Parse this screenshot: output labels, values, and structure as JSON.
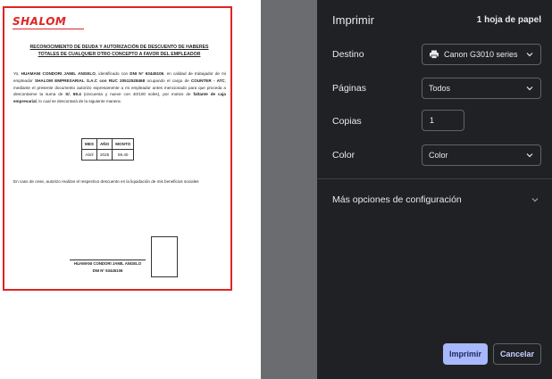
{
  "document": {
    "logo_text": "SHALOM",
    "title_line1": "RECONOCIMIENTO DE DEUDA Y AUTORIZACIÓN DE DESCUENTO DE HABERES",
    "title_line2": "TOTALES DE CUALQUIER OTRO CONCEPTO A FAVOR DEL EMPLEADOR",
    "body_p1": "Yo, ",
    "body_name": "HUAMANI CONDORI JAMIL ANGELO",
    "body_p2": ", identificado con ",
    "body_dni": "DNI N° 63445106",
    "body_p3": ", en calidad de trabajador de mi empleador ",
    "body_company": "SHALOM EMPRESARIAL S.A.C con RUC 20512528468",
    "body_p4": " ocupando el cargo de ",
    "body_role": "COUNTER - ATC",
    "body_p5": ", mediante el presente documento autorizo expresamente a mi empleador antes mencionado para que proceda a descontarme la suma de ",
    "body_amount": "S/. 59.4",
    "body_p6": " (cincuenta y nueve con 40/100 soles), por motivo de ",
    "body_reason": "faltante de caja empresarial",
    "body_p7": ", lo cual se descontará de la siguiente manera:",
    "table": {
      "headers": [
        "MES",
        "AÑO",
        "MONTO"
      ],
      "row": [
        "Abril",
        "2025",
        "59.40"
      ]
    },
    "cese_text": "En caso de cese, autorizo realizar el respectivo descuento en la liquidación de mis beneficios sociales",
    "signature_name": "HUAMANI CONDORI JAMIL ANGELO",
    "signature_dni": "DNI N° 63445106"
  },
  "panel": {
    "title": "Imprimir",
    "sheet_count": "1 hoja de papel",
    "destino_label": "Destino",
    "destino_value": "Canon G3010 series",
    "paginas_label": "Páginas",
    "paginas_value": "Todos",
    "copias_label": "Copias",
    "copias_value": "1",
    "color_label": "Color",
    "color_value": "Color",
    "more_options": "Más opciones de configuración",
    "print_button": "Imprimir",
    "cancel_button": "Cancelar"
  },
  "colors": {
    "accent_button": "#a8b8ff",
    "document_border": "#e02424",
    "panel_bg": "#202124"
  }
}
